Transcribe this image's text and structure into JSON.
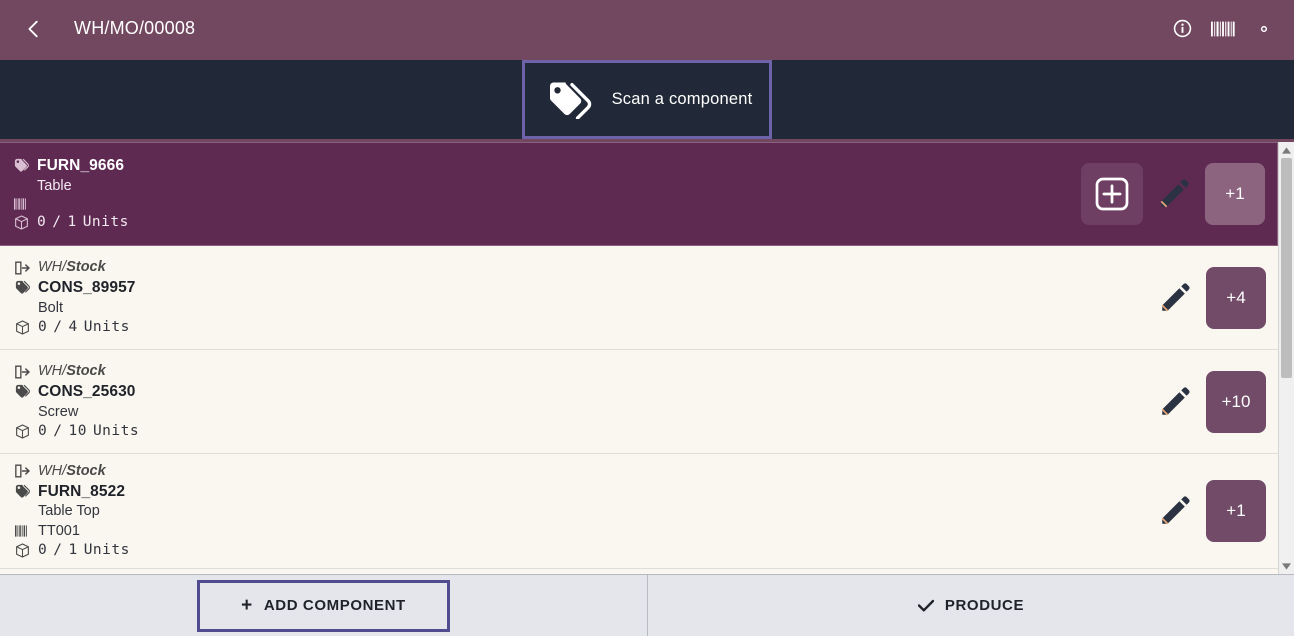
{
  "header": {
    "back_icon": "chevron-left-icon",
    "title": "WH/MO/00008",
    "icons": [
      {
        "name": "info-icon"
      },
      {
        "name": "barcode-icon"
      },
      {
        "name": "gear-icon"
      }
    ]
  },
  "scan": {
    "icon": "tags-icon",
    "label": "Scan a component"
  },
  "list": {
    "rows": [
      {
        "selected": true,
        "location": null,
        "location_prefix": null,
        "location_name": null,
        "code": "FURN_9666",
        "description": "Table",
        "lot": "",
        "has_lot_line": true,
        "qty_done": "0",
        "qty_sep": "/",
        "qty_total": "1",
        "qty_unit": "Units",
        "add_button": "plus-square-icon",
        "edit_button": "pencil-icon",
        "qty_button": "+1"
      },
      {
        "selected": false,
        "location_prefix": "WH/",
        "location_name": "Stock",
        "code": "CONS_89957",
        "description": "Bolt",
        "lot": null,
        "has_lot_line": false,
        "qty_done": "0",
        "qty_sep": "/",
        "qty_total": "4",
        "qty_unit": "Units",
        "add_button": null,
        "edit_button": "pencil-icon",
        "qty_button": "+4"
      },
      {
        "selected": false,
        "location_prefix": "WH/",
        "location_name": "Stock",
        "code": "CONS_25630",
        "description": "Screw",
        "lot": null,
        "has_lot_line": false,
        "qty_done": "0",
        "qty_sep": "/",
        "qty_total": "10",
        "qty_unit": "Units",
        "add_button": null,
        "edit_button": "pencil-icon",
        "qty_button": "+10"
      },
      {
        "selected": false,
        "location_prefix": "WH/",
        "location_name": "Stock",
        "code": "FURN_8522",
        "description": "Table Top",
        "lot": "TT001",
        "has_lot_line": true,
        "qty_done": "0",
        "qty_sep": "/",
        "qty_total": "1",
        "qty_unit": "Units",
        "add_button": null,
        "edit_button": "pencil-icon",
        "qty_button": "+1"
      }
    ]
  },
  "footer": {
    "add_component_label": "ADD COMPONENT",
    "add_component_plus": "+",
    "produce_label": "PRODUCE",
    "produce_check": "check-icon"
  },
  "colors": {
    "brand_purple": "#71485f",
    "selected_row": "#5e2a52",
    "dark_navy": "#212837",
    "scan_border": "#6e62a8",
    "qty_button": "#714b67",
    "focus_border": "#504c8f",
    "row_bg": "#faf7f0",
    "footer_bg": "#e4e6ec"
  }
}
